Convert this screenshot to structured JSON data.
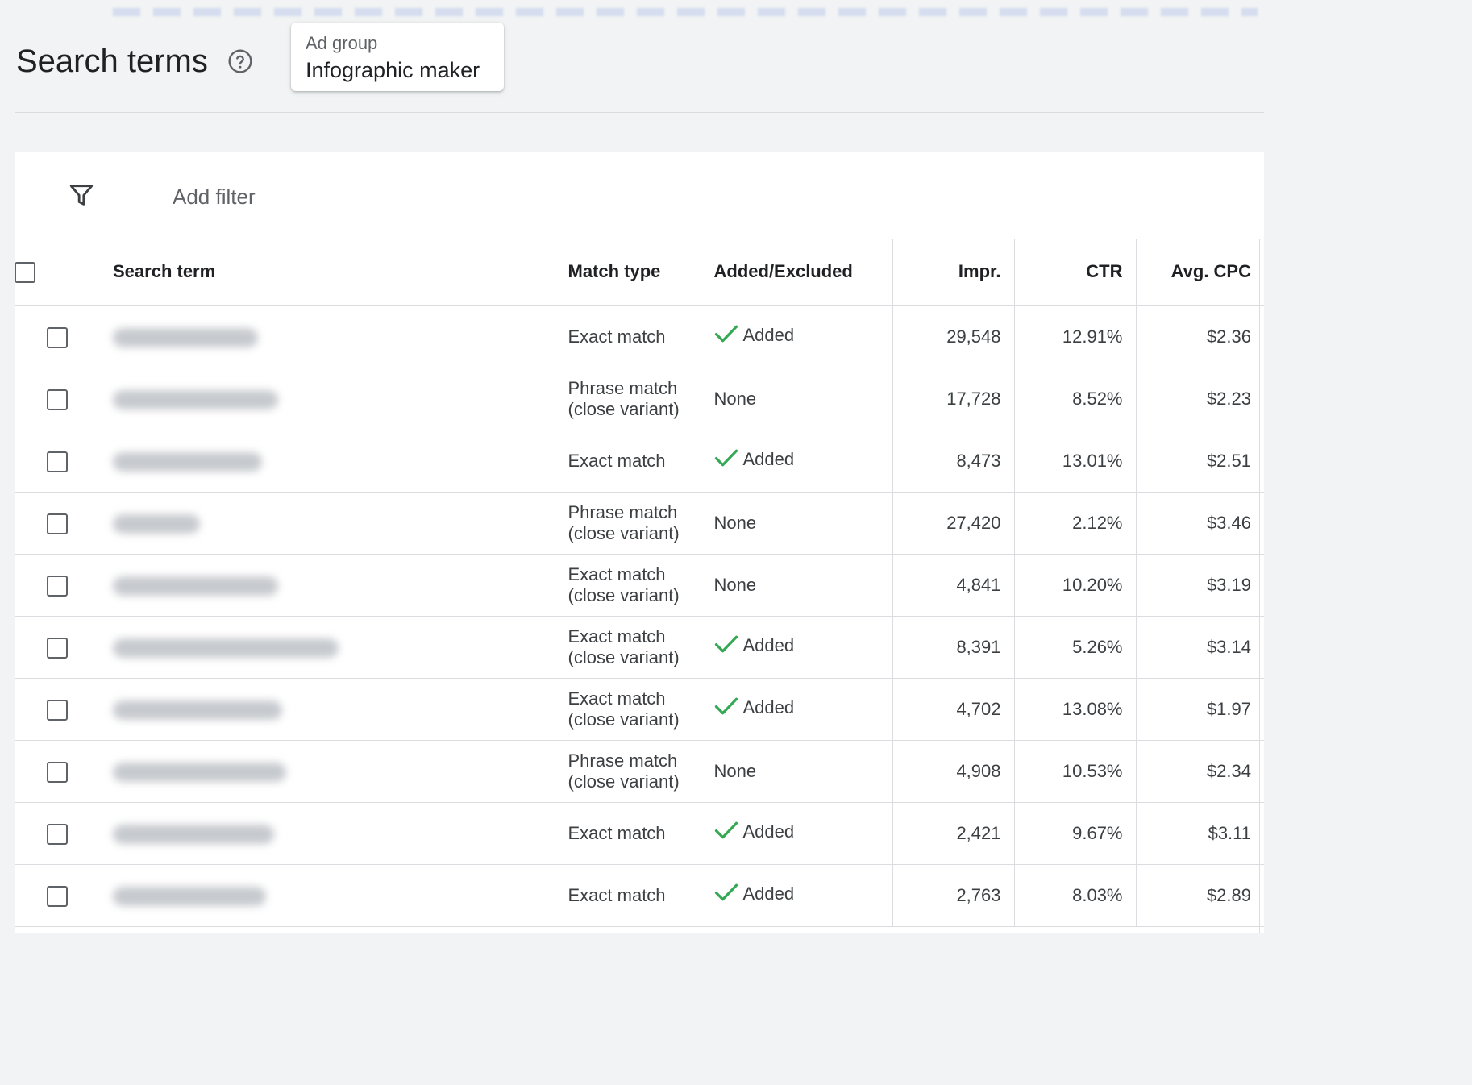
{
  "page": {
    "title": "Search terms"
  },
  "ad_group": {
    "label": "Ad group",
    "value": "Infographic maker"
  },
  "filter": {
    "label": "Add filter"
  },
  "table": {
    "columns": {
      "search_term": "Search term",
      "match_type": "Match type",
      "added_excluded": "Added/Excluded",
      "impr": "Impr.",
      "ctr": "CTR",
      "avg_cpc": "Avg. CPC"
    },
    "rows": [
      {
        "match_type": "Exact match",
        "status": "Added",
        "added": true,
        "impr": "29,548",
        "ctr": "12.91%",
        "cpc": "$2.36"
      },
      {
        "match_type": "Phrase match (close variant)",
        "status": "None",
        "added": false,
        "impr": "17,728",
        "ctr": "8.52%",
        "cpc": "$2.23"
      },
      {
        "match_type": "Exact match",
        "status": "Added",
        "added": true,
        "impr": "8,473",
        "ctr": "13.01%",
        "cpc": "$2.51"
      },
      {
        "match_type": "Phrase match (close variant)",
        "status": "None",
        "added": false,
        "impr": "27,420",
        "ctr": "2.12%",
        "cpc": "$3.46"
      },
      {
        "match_type": "Exact match (close variant)",
        "status": "None",
        "added": false,
        "impr": "4,841",
        "ctr": "10.20%",
        "cpc": "$3.19"
      },
      {
        "match_type": "Exact match (close variant)",
        "status": "Added",
        "added": true,
        "impr": "8,391",
        "ctr": "5.26%",
        "cpc": "$3.14"
      },
      {
        "match_type": "Exact match (close variant)",
        "status": "Added",
        "added": true,
        "impr": "4,702",
        "ctr": "13.08%",
        "cpc": "$1.97"
      },
      {
        "match_type": "Phrase match (close variant)",
        "status": "None",
        "added": false,
        "impr": "4,908",
        "ctr": "10.53%",
        "cpc": "$2.34"
      },
      {
        "match_type": "Exact match",
        "status": "Added",
        "added": true,
        "impr": "2,421",
        "ctr": "9.67%",
        "cpc": "$3.11"
      },
      {
        "match_type": "Exact match",
        "status": "Added",
        "added": true,
        "impr": "2,763",
        "ctr": "8.03%",
        "cpc": "$2.89"
      }
    ]
  },
  "colors": {
    "added_check": "#34a853",
    "border": "#dadce0",
    "background": "#f1f3f4"
  }
}
